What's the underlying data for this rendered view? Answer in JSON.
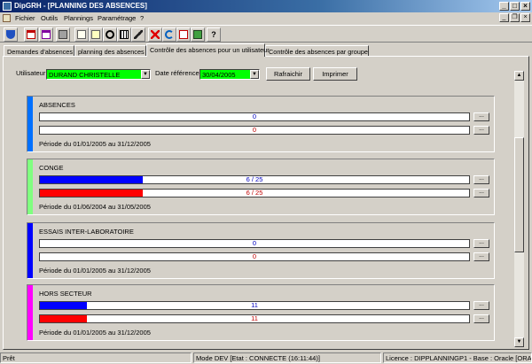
{
  "window": {
    "title": "DipGRH - [PLANNING DES ABSENCES]"
  },
  "menu": {
    "items": [
      "Fichier",
      "Outils",
      "Plannings",
      "Paramétrage",
      "?"
    ]
  },
  "toolbar": {
    "help_label": "?"
  },
  "tabs": [
    {
      "label": "Demandes d'absences"
    },
    {
      "label": "planning des absences"
    },
    {
      "label": "Contrôle des absences pour un utilisateur"
    },
    {
      "label": "Contrôle des absences par groupe"
    }
  ],
  "filters": {
    "user_label": "Utilisateur",
    "user_value": "DURAND CHRISTELLE",
    "date_label": "Date référence",
    "date_value": "30/04/2005",
    "refresh_label": "Rafraichir",
    "print_label": "Imprimer"
  },
  "cards": [
    {
      "title": "ABSENCES",
      "color": "#0070ff",
      "bar1": {
        "text": "0",
        "fraction": 0
      },
      "bar2": {
        "text": "0",
        "fraction": 0
      },
      "period": "Période du 01/01/2005 au 31/12/2005"
    },
    {
      "title": "CONGE",
      "color": "#80ff80",
      "bar1": {
        "text": "6 / 25",
        "fraction": 0.24
      },
      "bar2": {
        "text": "6 / 25",
        "fraction": 0.24
      },
      "period": "Période du 01/06/2004 au 31/05/2005"
    },
    {
      "title": "ESSAIS INTER-LABORATOIRE",
      "color": "#0000ff",
      "bar1": {
        "text": "0",
        "fraction": 0
      },
      "bar2": {
        "text": "0",
        "fraction": 0
      },
      "period": "Période du 01/01/2005 au 31/12/2005"
    },
    {
      "title": "HORS SECTEUR",
      "color": "#ff00ff",
      "bar1": {
        "text": "11",
        "fraction": 0.11
      },
      "bar2": {
        "text": "11",
        "fraction": 0.11
      },
      "period": "Période du 01/01/2005 au 31/12/2005"
    }
  ],
  "dots_label": "...",
  "colors": {
    "used_fill": "#0000ff",
    "taken_fill": "#ff0000"
  },
  "status": {
    "ready": "Prêt",
    "mode": "Mode DEV [Etat : CONNECTE (16:11:44)]",
    "licence": "Licence : DIPPLANNINGP1 - Base : Oracle [ORAC"
  }
}
